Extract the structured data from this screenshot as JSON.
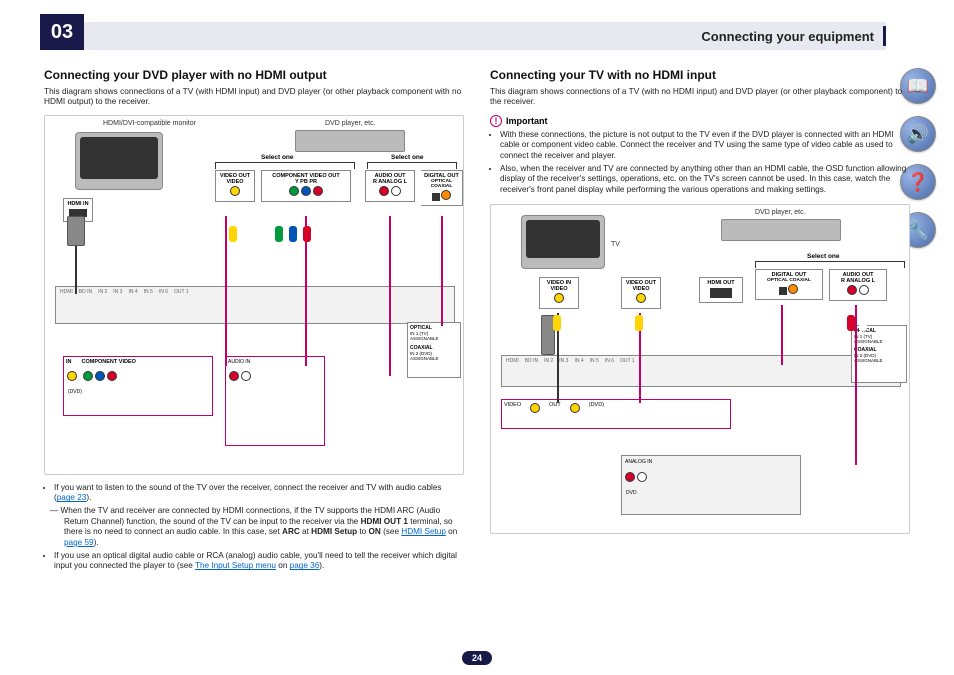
{
  "chapter": {
    "number": "03",
    "title": "Connecting your equipment"
  },
  "page_number": "24",
  "left": {
    "title": "Connecting your DVD player with no HDMI output",
    "desc": "This diagram shows connections of a TV (with HDMI input) and DVD player (or other playback component with no HDMI output) to the receiver.",
    "diagram": {
      "monitor_label": "HDMI/DVI-compatible monitor",
      "dvd_label": "DVD player, etc.",
      "hdmi_in": "HDMI IN",
      "select_one": "Select one",
      "video_out": "VIDEO OUT",
      "video": "VIDEO",
      "component_video_out": "COMPONENT VIDEO OUT",
      "ypbpr": "Y   PB   PR",
      "audio_out": "AUDIO OUT",
      "analog": "R  ANALOG  L",
      "digital_out": "DIGITAL OUT",
      "opt_coax": "OPTICAL   COAXIAL",
      "recv_hdmi": "HDMI",
      "recv_video": "VIDEO",
      "recv_comp": "COMPONENT VIDEO",
      "recv_dvd": "(DVD)",
      "recv_out1": "OUT 1",
      "optical": "OPTICAL",
      "coaxial": "COAXIAL",
      "assignable": "ASSIGNABLE",
      "in1_tv": "IN 1 (TV)",
      "in2_dvd": "IN 2 (DVD)"
    },
    "bullets": [
      {
        "text": "If you want to listen to the sound of the TV over the receiver, connect the receiver and TV with audio cables (",
        "link": "page 23",
        "after": ")."
      },
      {
        "sub": true,
        "text": "When the TV and receiver are connected by HDMI connections, if the TV supports the HDMI ARC (Audio Return Channel) function, the sound of the TV can be input to the receiver via the ",
        "bold1": "HDMI OUT 1",
        "mid": " terminal, so there is no need to connect an audio cable. In this case, set ",
        "bold2": "ARC",
        "mid2": " at ",
        "bold3": "HDMI Setup",
        "mid3": " to ",
        "bold4": "ON",
        "mid4": " (see ",
        "link": "HDMI Setup",
        "mid5": " on ",
        "link2": "page 59",
        "after": ")."
      },
      {
        "text": "If you use an optical digital audio cable or RCA (analog) audio cable, you'll need to tell the receiver which digital input you connected the player to (see ",
        "link": "The Input Setup menu",
        "mid": " on ",
        "link2": "page 36",
        "after": ")."
      }
    ]
  },
  "right": {
    "title": "Connecting your TV with no HDMI input",
    "desc": "This diagram shows connections of a TV (with no HDMI input) and DVD player (or other playback component) to the receiver.",
    "important_label": "Important",
    "important": [
      "With these connections, the picture is not output to the TV even if the DVD player is connected with an HDMI cable or component video cable. Connect the receiver and TV using the same type of video cable as used to connect the receiver and player.",
      "Also, when the receiver and TV are connected by anything other than an HDMI cable, the OSD function allowing display of the receiver's settings, operations, etc. on the TV's screen cannot be used. In this case, watch the receiver's front panel display while performing the various operations and making settings."
    ],
    "diagram": {
      "tv_label": "TV",
      "dvd_label": "DVD player, etc.",
      "video_in": "VIDEO IN",
      "video_out": "VIDEO OUT",
      "video": "VIDEO",
      "hdmi_out": "HDMI OUT",
      "select_one": "Select one",
      "digital_out": "DIGITAL OUT",
      "audio_out": "AUDIO OUT",
      "opt_coax": "OPTICAL   COAXIAL",
      "analog": "R  ANALOG  L",
      "recv_hdmi": "HDMI",
      "recv_video": "VIDEO",
      "recv_out": "OUT",
      "recv_dvd": "(DVD)",
      "optical": "OPTICAL",
      "coaxial": "COAXIAL",
      "assignable": "ASSIGNABLE",
      "in1_tv": "IN 1 (TV)",
      "in2_dvd": "IN 2 (DVD)",
      "analog_in": "ANALOG IN"
    }
  },
  "side_icons": [
    "book-icon",
    "speaker-icon",
    "help-icon",
    "wrench-icon"
  ]
}
